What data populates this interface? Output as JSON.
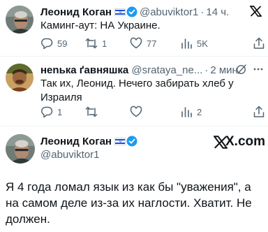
{
  "tweet1": {
    "name": "Леонид Коган",
    "handle": "@abuviktor1",
    "sep": "·",
    "time": "14 ч.",
    "text": "Каминг-аут: НА Украине.",
    "replies": "59",
    "retweets": "1",
    "likes": "77",
    "views": "5K"
  },
  "tweet2": {
    "name": "нenька ґавняшка",
    "handle": "@srataya_ne...",
    "sep": "·",
    "time": "2 мин.",
    "text": "Так их, Леонид. Нечего забирать хлеб у Израиля",
    "replies": "1",
    "retweets": "",
    "likes": "",
    "views": "2"
  },
  "quote": {
    "name": "Леонид Коган",
    "handle": "@abuviktor1",
    "brand": "X.com",
    "text": "Я 4 года ломал язык из как бы \"уважения\", а на самом деле из-за их наглости. Хватит. Не должен."
  },
  "colors": {
    "text": "#0f1419",
    "muted": "#536471",
    "verified": "#1d9bf0",
    "divider": "#eff3f4"
  },
  "icons": [
    "x-logo-icon",
    "reply-icon",
    "retweet-icon",
    "like-icon",
    "views-icon",
    "share-icon",
    "verified-badge-icon",
    "israel-flag-icon",
    "grok-icon",
    "more-icon"
  ]
}
